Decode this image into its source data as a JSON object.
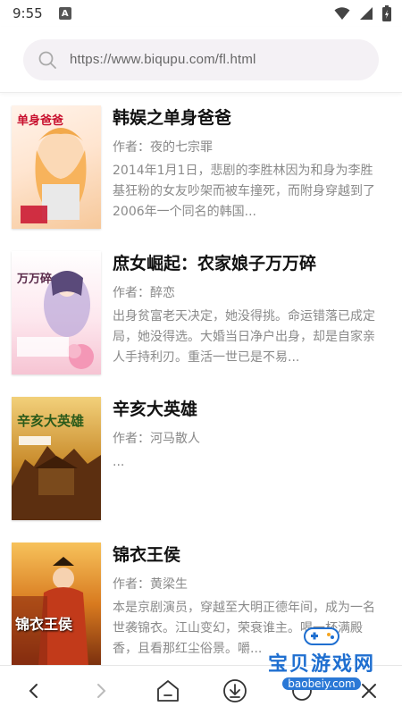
{
  "status": {
    "time": "9:55",
    "notif_icon": "A"
  },
  "browser": {
    "url": "https://www.biqupu.com/fl.html"
  },
  "books": [
    {
      "title": "韩娱之单身爸爸",
      "author": "作者：夜的七宗罪",
      "description": "2014年1月1日，悲剧的李胜林因为和身为李胜基狂粉的女友吵架而被车撞死，而附身穿越到了2006年一个同名的韩国...",
      "cover_text": "单身爸爸"
    },
    {
      "title": "庶女崛起：农家娘子万万碎",
      "author": "作者：醉恋",
      "description": "出身贫富老天决定，她没得挑。命运错落已成定局，她没得选。大婚当日净户出身，却是自家亲人手持利刃。重活一世已是不易...",
      "cover_text": "万万碎"
    },
    {
      "title": "辛亥大英雄",
      "author": "作者：河马散人",
      "description": "...",
      "cover_text": "辛亥大英雄"
    },
    {
      "title": "锦衣王侯",
      "author": "作者：黄梁生",
      "description": "本是京剧演员，穿越至大明正德年间，成为一名世袭锦衣。江山变幻，荣衰谁主。喝一杯满殿香，且看那红尘俗景。嚼...",
      "cover_text": "锦衣王侯"
    }
  ],
  "watermark": {
    "brand": "宝贝游戏网",
    "url": "baobeiy.com"
  },
  "nav": {
    "back_icon": "chevron-left-icon",
    "forward_icon": "chevron-right-icon",
    "home_icon": "home-icon",
    "download_icon": "download-icon",
    "close_icon": "close-icon"
  },
  "colors": {
    "title": "#111111",
    "meta": "#888888",
    "urlbar_bg": "#f4f1f5",
    "watermark_blue": "#1f6fd0"
  }
}
